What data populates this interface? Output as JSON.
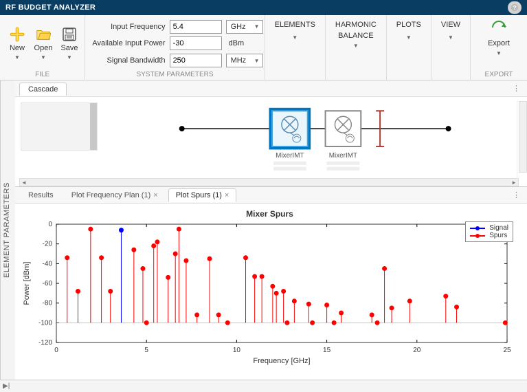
{
  "title": "RF BUDGET ANALYZER",
  "toolstrip": {
    "file": {
      "new": "New",
      "open": "Open",
      "save": "Save",
      "group_label": "FILE"
    },
    "sysparams": {
      "input_freq_label": "Input Frequency",
      "input_freq_value": "5.4",
      "input_freq_unit": "GHz",
      "avail_power_label": "Available Input Power",
      "avail_power_value": "-30",
      "avail_power_unit": "dBm",
      "signal_bw_label": "Signal Bandwidth",
      "signal_bw_value": "250",
      "signal_bw_unit": "MHz",
      "group_label": "SYSTEM PARAMETERS"
    },
    "elements_label": "ELEMENTS",
    "harmonic_label1": "HARMONIC",
    "harmonic_label2": "BALANCE",
    "plots_label": "PLOTS",
    "view_label": "VIEW",
    "export_label": "Export",
    "export_group": "EXPORT"
  },
  "sidetab": "ELEMENT PARAMETERS",
  "cascade": {
    "tab_label": "Cascade",
    "block1_label": "MixerIMT",
    "block2_label": "MixerIMT"
  },
  "result_tabs": {
    "results": "Results",
    "plot_freq": "Plot Frequency Plan (1)",
    "plot_spurs": "Plot Spurs (1)"
  },
  "chart": {
    "title": "Mixer Spurs",
    "xlabel": "Frequency [GHz]",
    "ylabel": "Power [dBm]",
    "legend_signal": "Signal",
    "legend_spurs": "Spurs"
  },
  "chart_data": {
    "type": "scatter",
    "title": "Mixer Spurs",
    "xlabel": "Frequency [GHz]",
    "ylabel": "Power [dBm]",
    "xlim": [
      0,
      25
    ],
    "ylim": [
      -120,
      0
    ],
    "xticks": [
      0,
      5,
      10,
      15,
      20,
      25
    ],
    "yticks": [
      0,
      -20,
      -40,
      -60,
      -80,
      -100,
      -120
    ],
    "series": [
      {
        "name": "Signal",
        "color": "#0000ff",
        "points": [
          {
            "x": 3.6,
            "y": -6
          }
        ]
      },
      {
        "name": "Spurs",
        "color": "#ff0000",
        "points": [
          {
            "x": 0.6,
            "y": -34
          },
          {
            "x": 1.2,
            "y": -68
          },
          {
            "x": 1.9,
            "y": -5
          },
          {
            "x": 2.5,
            "y": -34
          },
          {
            "x": 3.0,
            "y": -68
          },
          {
            "x": 4.3,
            "y": -26
          },
          {
            "x": 4.8,
            "y": -45
          },
          {
            "x": 5.0,
            "y": -100
          },
          {
            "x": 5.4,
            "y": -22
          },
          {
            "x": 5.6,
            "y": -18
          },
          {
            "x": 6.2,
            "y": -54
          },
          {
            "x": 6.6,
            "y": -30
          },
          {
            "x": 6.8,
            "y": -5
          },
          {
            "x": 7.2,
            "y": -37
          },
          {
            "x": 7.8,
            "y": -92
          },
          {
            "x": 8.5,
            "y": -35
          },
          {
            "x": 9.0,
            "y": -92
          },
          {
            "x": 9.5,
            "y": -100
          },
          {
            "x": 10.5,
            "y": -34
          },
          {
            "x": 11.0,
            "y": -53
          },
          {
            "x": 11.4,
            "y": -53
          },
          {
            "x": 12.0,
            "y": -63
          },
          {
            "x": 12.2,
            "y": -70
          },
          {
            "x": 12.6,
            "y": -68
          },
          {
            "x": 12.8,
            "y": -100
          },
          {
            "x": 13.2,
            "y": -78
          },
          {
            "x": 14.0,
            "y": -81
          },
          {
            "x": 14.2,
            "y": -100
          },
          {
            "x": 15.0,
            "y": -82
          },
          {
            "x": 15.4,
            "y": -100
          },
          {
            "x": 15.8,
            "y": -90
          },
          {
            "x": 17.5,
            "y": -92
          },
          {
            "x": 17.8,
            "y": -100
          },
          {
            "x": 18.2,
            "y": -45
          },
          {
            "x": 18.6,
            "y": -85
          },
          {
            "x": 19.6,
            "y": -78
          },
          {
            "x": 21.6,
            "y": -73
          },
          {
            "x": 22.2,
            "y": -84
          },
          {
            "x": 24.9,
            "y": -100
          }
        ]
      }
    ]
  }
}
